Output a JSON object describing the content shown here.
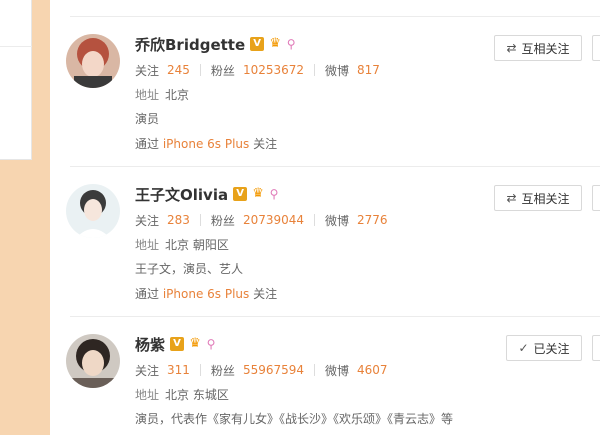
{
  "users": [
    {
      "name": "乔欣Bridgette",
      "stats": {
        "follow_label": "关注",
        "follow_count": "245",
        "fans_label": "粉丝",
        "fans_count": "10253672",
        "weibo_label": "微博",
        "weibo_count": "817"
      },
      "address_label": "地址",
      "address": "北京",
      "bio": "演员",
      "via_prefix": "通过",
      "via_device": "iPhone 6s Plus",
      "via_suffix": "关注",
      "button_label": "互相关注",
      "button_icon": "mutual-arrows-icon"
    },
    {
      "name": "王子文Olivia",
      "stats": {
        "follow_label": "关注",
        "follow_count": "283",
        "fans_label": "粉丝",
        "fans_count": "20739044",
        "weibo_label": "微博",
        "weibo_count": "2776"
      },
      "address_label": "地址",
      "address": "北京 朝阳区",
      "bio": "王子文，演员、艺人",
      "via_prefix": "通过",
      "via_device": "iPhone 6s Plus",
      "via_suffix": "关注",
      "button_label": "互相关注",
      "button_icon": "mutual-arrows-icon"
    },
    {
      "name": "杨紫",
      "stats": {
        "follow_label": "关注",
        "follow_count": "311",
        "fans_label": "粉丝",
        "fans_count": "55967594",
        "weibo_label": "微博",
        "weibo_count": "4607"
      },
      "address_label": "地址",
      "address": "北京 东城区",
      "bio": "演员，代表作《家有儿女》《战长沙》《欢乐颂》《青云志》等",
      "button_label": "已关注",
      "button_icon": "check-icon"
    }
  ],
  "badges": {
    "verified": "V",
    "crown": "♛",
    "key": "⚲"
  },
  "colors": {
    "accent": "#e8823a",
    "verified": "#e8a21a",
    "background": "#f7d5b0"
  }
}
